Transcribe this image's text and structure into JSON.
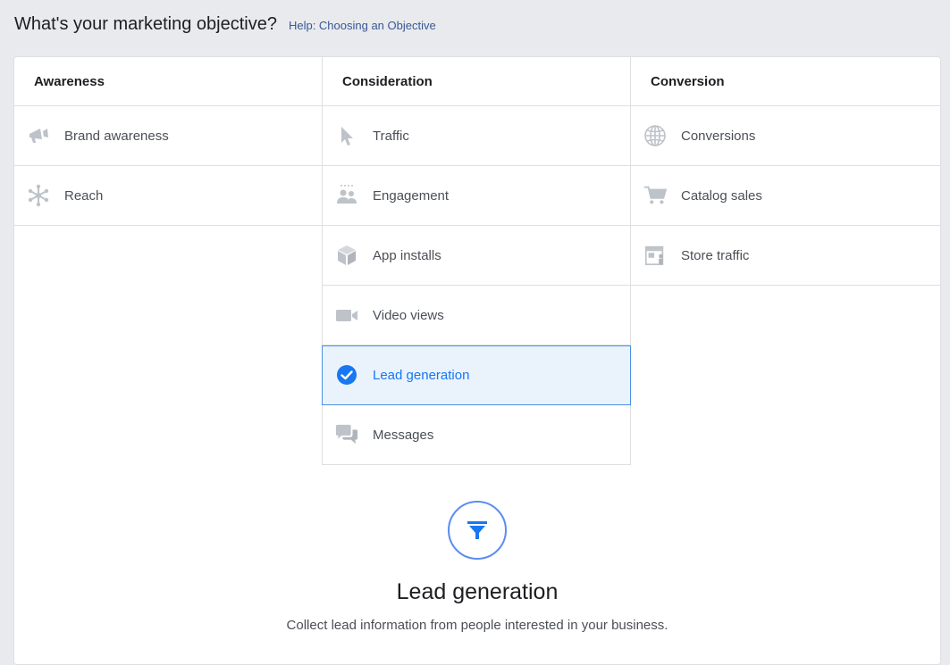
{
  "header": {
    "title": "What's your marketing objective?",
    "help_link": "Help: Choosing an Objective"
  },
  "columns": [
    {
      "title": "Awareness",
      "items": [
        {
          "label": "Brand awareness",
          "icon": "megaphone-icon"
        },
        {
          "label": "Reach",
          "icon": "reach-icon"
        }
      ]
    },
    {
      "title": "Consideration",
      "items": [
        {
          "label": "Traffic",
          "icon": "cursor-icon"
        },
        {
          "label": "Engagement",
          "icon": "people-icon"
        },
        {
          "label": "App installs",
          "icon": "box-icon"
        },
        {
          "label": "Video views",
          "icon": "video-camera-icon"
        },
        {
          "label": "Lead generation",
          "icon": "checkmark-icon",
          "selected": true
        },
        {
          "label": "Messages",
          "icon": "chat-bubbles-icon"
        }
      ]
    },
    {
      "title": "Conversion",
      "items": [
        {
          "label": "Conversions",
          "icon": "globe-icon"
        },
        {
          "label": "Catalog sales",
          "icon": "cart-icon"
        },
        {
          "label": "Store traffic",
          "icon": "storefront-icon"
        }
      ]
    }
  ],
  "detail": {
    "icon": "funnel-icon",
    "title": "Lead generation",
    "description": "Collect lead information from people interested in your business."
  },
  "colors": {
    "icon_muted": "#bec3c9",
    "selected_text": "#1877f2",
    "selected_bg": "#eaf3fc",
    "selected_border": "#4a90e2",
    "accent_circle": "#5b8def"
  }
}
